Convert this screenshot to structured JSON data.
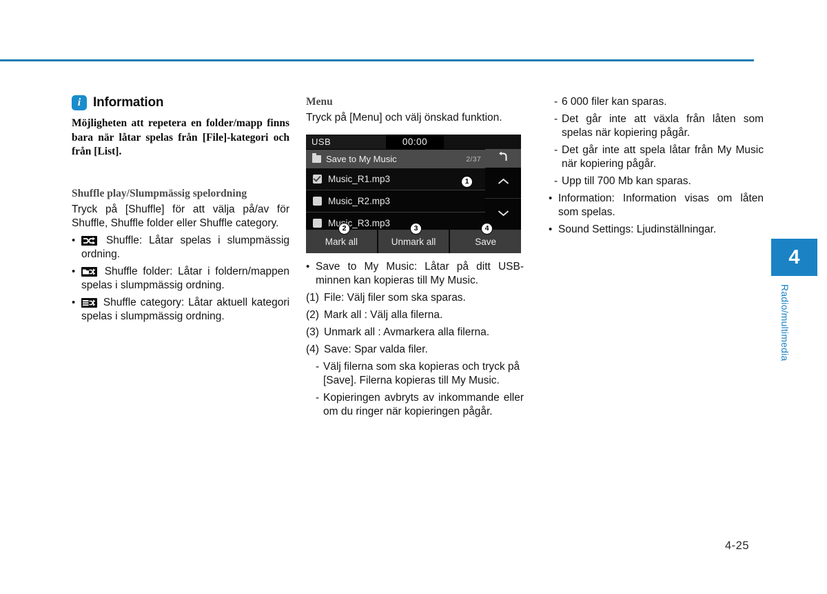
{
  "page": {
    "number": "4-25",
    "rule_color": "#1b7cb5"
  },
  "chapter_tab": {
    "number": "4",
    "label": "Radio/multimedia",
    "color": "#1b83c4"
  },
  "left_column": {
    "info_box": {
      "icon": "info-icon",
      "title": "Information",
      "body": "Möjligheten att repetera en folder/mapp finns bara när låtar spelas från [File]-kategori och från [List]."
    },
    "section_heading": "Shuffle play/Slumpmässig spelordning",
    "intro": "Tryck på [Shuffle] för att välja på/av för Shuffle, Shuffle folder eller Shuffle category.",
    "bullets": [
      {
        "icon": "shuffle-icon",
        "text": "Shuffle: Låtar spelas i slumpmässig ordning."
      },
      {
        "icon": "shuffle-folder-icon",
        "text": "Shuffle folder: Låtar i foldern/mappen spelas i slumpmässig ordning."
      },
      {
        "icon": "shuffle-category-icon",
        "text": "Shuffle category: Låtar aktuell kategori spelas i slumpmässig ordning."
      }
    ]
  },
  "middle_column": {
    "section_heading": "Menu",
    "intro": "Tryck på [Menu] och välj önskad funktion.",
    "head_unit": {
      "source": "USB",
      "clock": "00:00",
      "list_title": "Save to My Music",
      "list_count": "2/37",
      "back_icon": "back-arrow-icon",
      "scroll_up_icon": "chevron-up-icon",
      "scroll_down_icon": "chevron-down-icon",
      "folder_icon": "folder-icon",
      "rows": [
        {
          "name": "Music_R1.mp3",
          "checked": true
        },
        {
          "name": "Music_R2.mp3",
          "checked": false
        },
        {
          "name": "Music_R3.mp3",
          "checked": false
        }
      ],
      "buttons": [
        {
          "label": "Mark all"
        },
        {
          "label": "Unmark all"
        },
        {
          "label": "Save"
        }
      ],
      "callouts": [
        {
          "id": "1",
          "symbol": "❶"
        },
        {
          "id": "2",
          "symbol": "❷"
        },
        {
          "id": "3",
          "symbol": "❸"
        },
        {
          "id": "4",
          "symbol": "❹"
        }
      ]
    },
    "bullet": "Save to My Music: Låtar på ditt USB-minnen kan kopieras till My Music.",
    "numbered": [
      {
        "label": "(1)",
        "text": "File: Välj filer som ska sparas."
      },
      {
        "label": "(2)",
        "text": "Mark all : Välj alla filerna."
      },
      {
        "label": "(3)",
        "text": "Unmark all : Avmarkera alla filerna."
      },
      {
        "label": "(4)",
        "text": "Save: Spar valda filer."
      }
    ],
    "dashes": [
      "Välj filerna som ska kopieras och tryck på [Save]. Filerna kopieras till My Music.",
      "Kopieringen avbryts av inkommande eller om du ringer när kopieringen pågår."
    ]
  },
  "right_column": {
    "dashes": [
      "6 000 filer kan sparas.",
      "Det går inte att växla från låten som spelas när kopiering pågår.",
      "Det går inte att spela låtar från My Music när kopiering pågår.",
      "Upp till 700 Mb kan sparas."
    ],
    "bullets": [
      "Information: Information visas om låten som spelas.",
      "Sound Settings: Ljudinställningar."
    ]
  },
  "glyphs": {
    "bullet": "•",
    "dash": "-",
    "info_letter": "i"
  }
}
